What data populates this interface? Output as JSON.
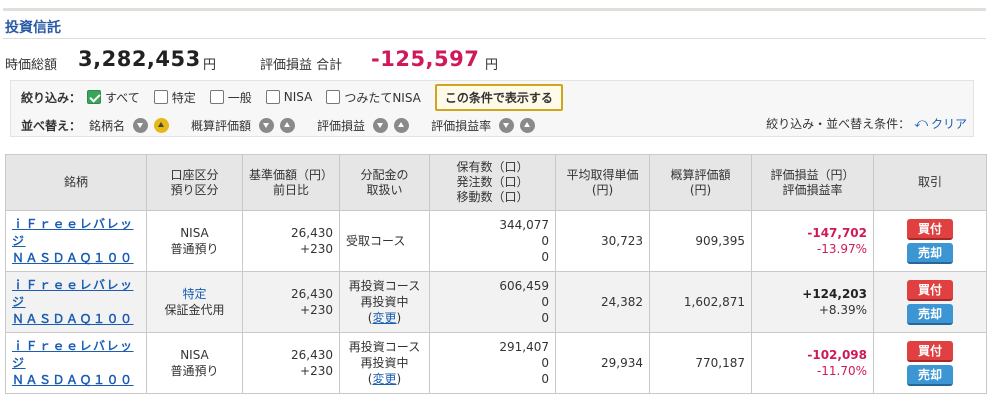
{
  "page": {
    "title": "投資信託"
  },
  "summary": {
    "market_value_label": "時価総額",
    "market_value": "3,282,453",
    "market_value_unit": "円",
    "pl_label": "評価損益 合計",
    "pl_value": "-125,597",
    "pl_unit": "円"
  },
  "filter": {
    "label": "絞り込み：",
    "options": [
      {
        "label": "すべて",
        "checked": true
      },
      {
        "label": "特定",
        "checked": false
      },
      {
        "label": "一般",
        "checked": false
      },
      {
        "label": "NISA",
        "checked": false
      },
      {
        "label": "つみたてNISA",
        "checked": false
      }
    ],
    "apply_button": "この条件で表示する"
  },
  "sort": {
    "label": "並べ替え：",
    "items": [
      {
        "label": "銘柄名",
        "active": "up"
      },
      {
        "label": "概算評価額",
        "active": "none"
      },
      {
        "label": "評価損益",
        "active": "none"
      },
      {
        "label": "評価損益率",
        "active": "none"
      }
    ],
    "clear_label": "絞り込み・並べ替え条件：",
    "clear_link": "クリア"
  },
  "table": {
    "headers": {
      "name": "銘柄",
      "account_1": "口座区分",
      "account_2": "預り区分",
      "price_1": "基準価額（円）",
      "price_2": "前日比",
      "dist_1": "分配金の",
      "dist_2": "取扱い",
      "qty_1": "保有数（口）",
      "qty_2": "発注数（口）",
      "qty_3": "移動数（口）",
      "avg_1": "平均取得単価",
      "avg_2": "(円)",
      "val_1": "概算評価額",
      "val_2": "(円)",
      "pl_1": "評価損益（円）",
      "pl_2": "評価損益率",
      "trade": "取引"
    },
    "rows": [
      {
        "name_1": "ｉＦｒｅｅレバレッジ",
        "name_2": "ＮＡＳＤＡＱ１００",
        "account": "NISA",
        "custody": "普通預り",
        "price": "26,430",
        "change": "+230",
        "dist_1": "受取コース",
        "dist_2": "",
        "dist_link": "",
        "held": "344,077",
        "ordered": "0",
        "moving": "0",
        "avg_cost": "30,723",
        "valuation": "909,395",
        "pl": "-147,702",
        "pl_rate": "-13.97%",
        "buy": "買付",
        "sell": "売却"
      },
      {
        "name_1": "ｉＦｒｅｅレバレッジ",
        "name_2": "ＮＡＳＤＡＱ１００",
        "account": "特定",
        "custody": "保証金代用",
        "price": "26,430",
        "change": "+230",
        "dist_1": "再投資コース",
        "dist_2": "再投資中",
        "dist_link": "変更",
        "held": "606,459",
        "ordered": "0",
        "moving": "0",
        "avg_cost": "24,382",
        "valuation": "1,602,871",
        "pl": "+124,203",
        "pl_rate": "+8.39%",
        "buy": "買付",
        "sell": "売却"
      },
      {
        "name_1": "ｉＦｒｅｅレバレッジ",
        "name_2": "ＮＡＳＤＡＱ１００",
        "account": "NISA",
        "custody": "普通預り",
        "price": "26,430",
        "change": "+230",
        "dist_1": "再投資コース",
        "dist_2": "再投資中",
        "dist_link": "変更",
        "held": "291,407",
        "ordered": "0",
        "moving": "0",
        "avg_cost": "29,934",
        "valuation": "770,187",
        "pl": "-102,098",
        "pl_rate": "-11.70%",
        "buy": "買付",
        "sell": "売却"
      }
    ]
  },
  "colors": {
    "title_blue": "#2a5aa6",
    "negative": "#d0195a",
    "buy_button": "#e04040",
    "sell_button": "#3b96d3",
    "checkbox_checked": "#3aa45a",
    "apply_border": "#d0a41c",
    "sort_active": "#e6b818"
  }
}
